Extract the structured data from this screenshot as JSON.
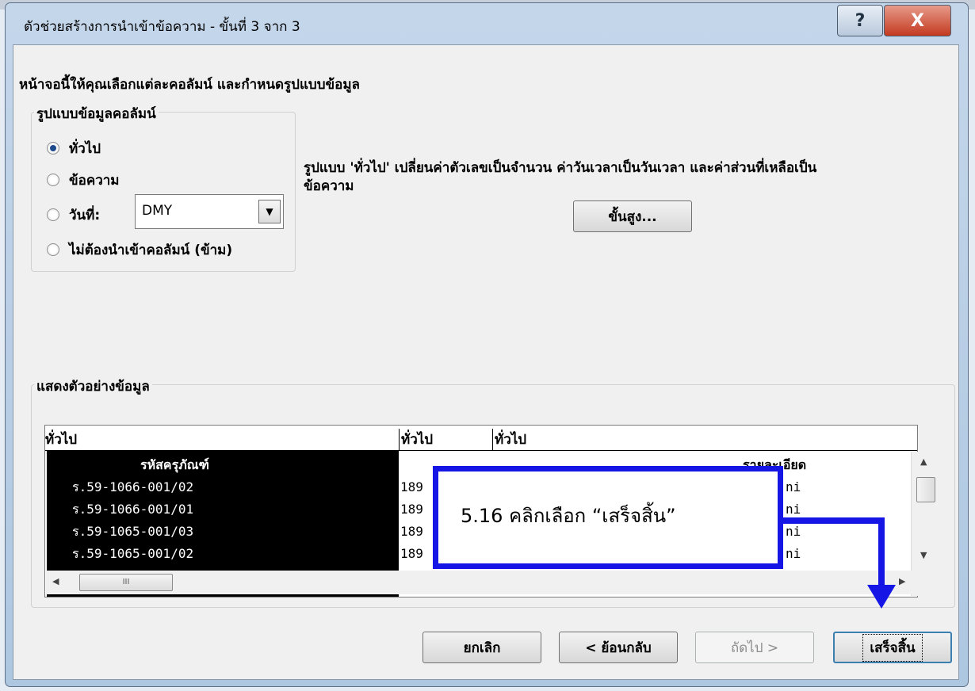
{
  "window": {
    "title": "ตัวช่วยสร้างการนำเข้าข้อความ - ขั้นที่ 3 จาก 3",
    "help_label": "?",
    "close_label": "X"
  },
  "instructions": "หน้าจอนี้ให้คุณเลือกแต่ละคอลัมน์ และกำหนดรูปแบบข้อมูล",
  "format_group": {
    "label": "รูปแบบข้อมูลคอลัมน์",
    "options": [
      {
        "label": "ทั่วไป",
        "selected": true
      },
      {
        "label": "ข้อความ",
        "selected": false
      },
      {
        "label": "วันที่:",
        "selected": false
      },
      {
        "label": "ไม่ต้องนำเข้าคอลัมน์ (ข้าม)",
        "selected": false
      }
    ],
    "date_format": "DMY"
  },
  "description": {
    "line1": "รูปแบบ 'ทั่วไป' เปลี่ยนค่าตัวเลขเป็นจำนวน ค่าวันเวลาเป็นวันเวลา และค่าส่วนที่เหลือเป็น",
    "line2": "ข้อความ"
  },
  "advanced_button": "ขั้นสูง...",
  "preview": {
    "label": "แสดงตัวอย่างข้อมูล",
    "col_headers": [
      "ทั่วไป",
      "ทั่วไป",
      "ทั่วไป"
    ],
    "col1_header": "รหัสครุภัณฑ์",
    "col3_header": "รายละเอียด",
    "rows": [
      {
        "c1": "ร.59-1066-001/02",
        "c2": "189",
        "c3": "ni"
      },
      {
        "c1": "ร.59-1066-001/01",
        "c2": "189",
        "c3": "ni"
      },
      {
        "c1": "ร.59-1065-001/03",
        "c2": "189",
        "c3": "ni"
      },
      {
        "c1": "ร.59-1065-001/02",
        "c2": "189",
        "c3": "ni"
      }
    ],
    "hscroll_thumb": "III"
  },
  "buttons": {
    "cancel": "ยกเลิก",
    "back": "< ย้อนกลับ",
    "next": "ถัดไป >",
    "finish": "เสร็จสิ้น"
  },
  "annotation": {
    "text": "5.16 คลิกเลือก “เสร็จสิ้น”",
    "color": "#1515e6"
  }
}
